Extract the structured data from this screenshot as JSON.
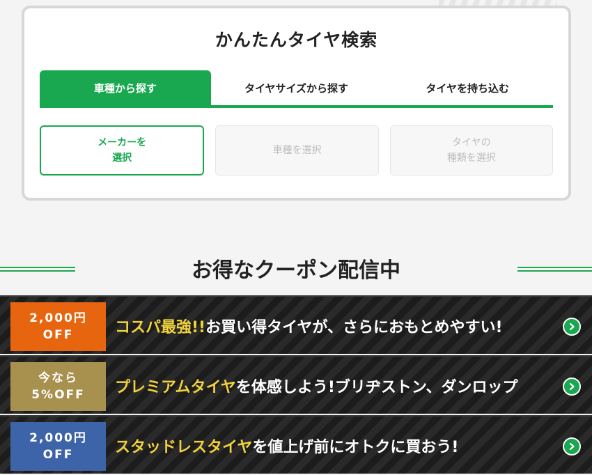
{
  "search": {
    "title": "かんたんタイヤ検索",
    "tabs": [
      {
        "label": "車種から探す",
        "active": true
      },
      {
        "label": "タイヤサイズから探す",
        "active": false
      },
      {
        "label": "タイヤを持ち込む",
        "active": false
      }
    ],
    "selectors": [
      {
        "label": "メーカーを\n選択",
        "enabled": true
      },
      {
        "label": "車種を選択",
        "enabled": false
      },
      {
        "label": "タイヤの\n種類を選択",
        "enabled": false
      }
    ]
  },
  "coupons": {
    "title": "お得なクーポン配信中",
    "items": [
      {
        "badge_line1": "2,000円",
        "badge_line2": "OFF",
        "badge_color": "#e8650f",
        "highlight": "コスパ最強!!",
        "text": "お買い得タイヤが、さらにおもとめやすい!"
      },
      {
        "badge_line1": "今なら",
        "badge_line2": "5%OFF",
        "badge_color": "#a8904e",
        "highlight": "プレミアムタイヤ",
        "text": "を体感しよう!ブリヂストン、ダンロップ"
      },
      {
        "badge_line1": "2,000円",
        "badge_line2": "OFF",
        "badge_color": "#3d63a8",
        "highlight": "スタッドレスタイヤ",
        "text": "を値上げ前にオトクに買おう!"
      }
    ]
  },
  "icons": {
    "arrow": "chevron-right-circle-icon"
  },
  "colors": {
    "accent": "#19a850",
    "highlight": "#f2d33c"
  }
}
